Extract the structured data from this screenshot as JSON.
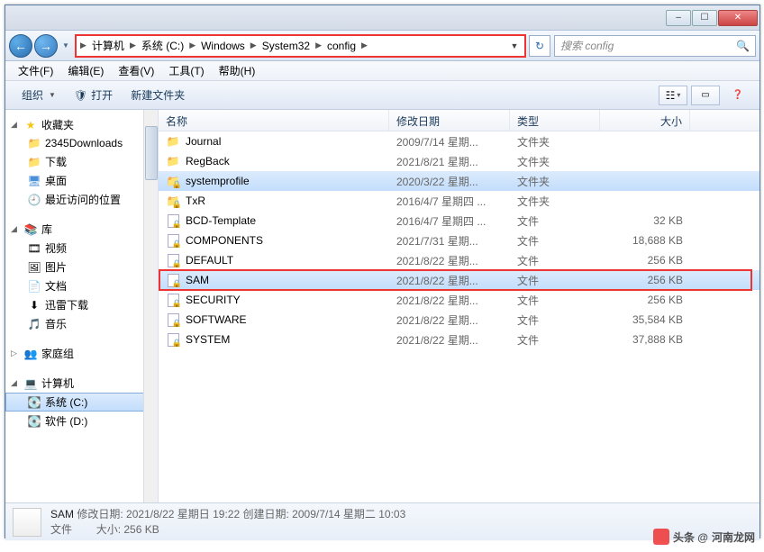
{
  "titlebar": {
    "min": "–",
    "max": "☐",
    "close": "✕"
  },
  "nav": {
    "back": "←",
    "forward": "→",
    "dropdown": "▼",
    "breadcrumbs": [
      "计算机",
      "系统 (C:)",
      "Windows",
      "System32",
      "config"
    ],
    "addr_dropdown": "▼",
    "refresh": "↻",
    "search_placeholder": "搜索 config",
    "search_icon": "🔍"
  },
  "menubar": [
    "文件(F)",
    "编辑(E)",
    "查看(V)",
    "工具(T)",
    "帮助(H)"
  ],
  "toolbar": {
    "organize": "组织",
    "open": "打开",
    "open_icon": "🛡",
    "newfolder": "新建文件夹",
    "view_icon": "☷",
    "help_icon": "❓"
  },
  "sidebar": {
    "favorites": {
      "label": "收藏夹",
      "items": [
        "2345Downloads",
        "下载",
        "桌面",
        "最近访问的位置"
      ]
    },
    "libraries": {
      "label": "库",
      "items": [
        "视频",
        "图片",
        "文档",
        "迅雷下载",
        "音乐"
      ]
    },
    "homegroup": {
      "label": "家庭组"
    },
    "computer": {
      "label": "计算机",
      "items": [
        "系统 (C:)",
        "软件 (D:)"
      ]
    }
  },
  "columns": {
    "name": "名称",
    "date": "修改日期",
    "type": "类型",
    "size": "大小"
  },
  "files": [
    {
      "icon": "folder",
      "name": "Journal",
      "date": "2009/7/14 星期...",
      "type": "文件夹",
      "size": "",
      "selected": false,
      "highlighted": false
    },
    {
      "icon": "folder",
      "name": "RegBack",
      "date": "2021/8/21 星期...",
      "type": "文件夹",
      "size": "",
      "selected": false,
      "highlighted": false
    },
    {
      "icon": "folder-lock",
      "name": "systemprofile",
      "date": "2020/3/22 星期...",
      "type": "文件夹",
      "size": "",
      "selected": true,
      "highlighted": false
    },
    {
      "icon": "folder-lock",
      "name": "TxR",
      "date": "2016/4/7 星期四 ...",
      "type": "文件夹",
      "size": "",
      "selected": false,
      "highlighted": false
    },
    {
      "icon": "file-lock",
      "name": "BCD-Template",
      "date": "2016/4/7 星期四 ...",
      "type": "文件",
      "size": "32 KB",
      "selected": false,
      "highlighted": false
    },
    {
      "icon": "file-lock",
      "name": "COMPONENTS",
      "date": "2021/7/31 星期...",
      "type": "文件",
      "size": "18,688 KB",
      "selected": false,
      "highlighted": false
    },
    {
      "icon": "file-lock",
      "name": "DEFAULT",
      "date": "2021/8/22 星期...",
      "type": "文件",
      "size": "256 KB",
      "selected": false,
      "highlighted": false
    },
    {
      "icon": "file-lock",
      "name": "SAM",
      "date": "2021/8/22 星期...",
      "type": "文件",
      "size": "256 KB",
      "selected": true,
      "highlighted": true
    },
    {
      "icon": "file-lock",
      "name": "SECURITY",
      "date": "2021/8/22 星期...",
      "type": "文件",
      "size": "256 KB",
      "selected": false,
      "highlighted": false
    },
    {
      "icon": "file-lock",
      "name": "SOFTWARE",
      "date": "2021/8/22 星期...",
      "type": "文件",
      "size": "35,584 KB",
      "selected": false,
      "highlighted": false
    },
    {
      "icon": "file-lock",
      "name": "SYSTEM",
      "date": "2021/8/22 星期...",
      "type": "文件",
      "size": "37,888 KB",
      "selected": false,
      "highlighted": false
    }
  ],
  "status": {
    "filename": "SAM",
    "modified_label": "修改日期:",
    "modified": "2021/8/22 星期日 19:22",
    "created_label": "创建日期:",
    "created": "2009/7/14 星期二 10:03",
    "type_label": "文件",
    "size_label": "大小:",
    "size": "256 KB"
  },
  "watermark": {
    "prefix": "头条 @",
    "text": "河南龙网"
  }
}
